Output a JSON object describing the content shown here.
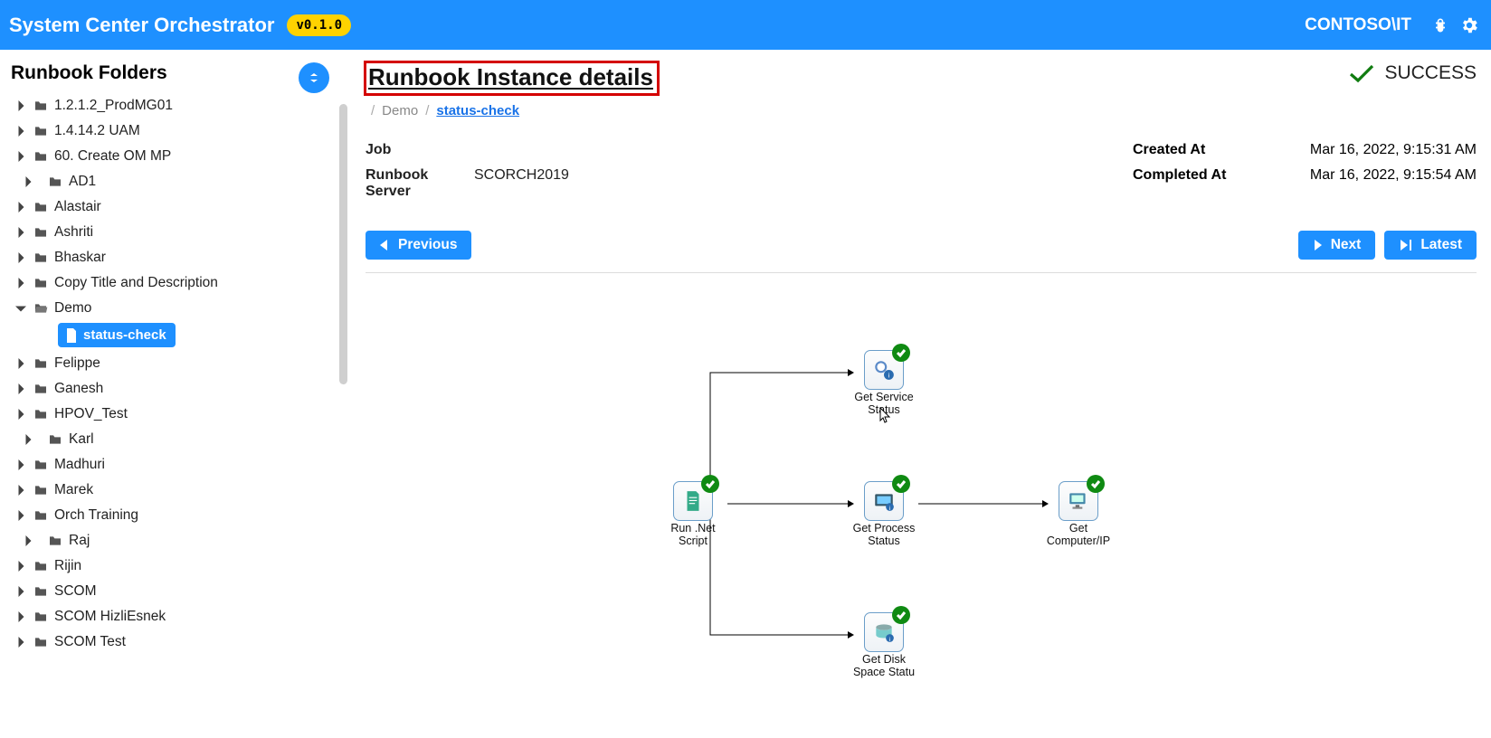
{
  "app": {
    "title": "System Center Orchestrator",
    "version": "v0.1.0",
    "user": "CONTOSO\\IT"
  },
  "sidebar": {
    "title": "Runbook Folders",
    "items": [
      {
        "label": "1.2.1.2_ProdMG01",
        "expanded": false,
        "depth": 1,
        "type": "folder"
      },
      {
        "label": "1.4.14.2 UAM",
        "expanded": false,
        "depth": 1,
        "type": "folder"
      },
      {
        "label": "60. Create OM MP",
        "expanded": false,
        "depth": 1,
        "type": "folder"
      },
      {
        "label": "AD1",
        "expanded": false,
        "depth": 2,
        "type": "folder"
      },
      {
        "label": "Alastair",
        "expanded": false,
        "depth": 1,
        "type": "folder"
      },
      {
        "label": "Ashriti",
        "expanded": false,
        "depth": 1,
        "type": "folder"
      },
      {
        "label": "Bhaskar",
        "expanded": false,
        "depth": 1,
        "type": "folder"
      },
      {
        "label": "Copy Title and Description",
        "expanded": false,
        "depth": 1,
        "type": "folder"
      },
      {
        "label": "Demo",
        "expanded": true,
        "depth": 1,
        "type": "folder-open"
      },
      {
        "label": "status-check",
        "depth": 3,
        "type": "file",
        "selected": true
      },
      {
        "label": "Felippe",
        "expanded": false,
        "depth": 1,
        "type": "folder"
      },
      {
        "label": "Ganesh",
        "expanded": false,
        "depth": 1,
        "type": "folder"
      },
      {
        "label": "HPOV_Test",
        "expanded": false,
        "depth": 1,
        "type": "folder"
      },
      {
        "label": "Karl",
        "expanded": false,
        "depth": 2,
        "type": "folder"
      },
      {
        "label": "Madhuri",
        "expanded": false,
        "depth": 1,
        "type": "folder"
      },
      {
        "label": "Marek",
        "expanded": false,
        "depth": 1,
        "type": "folder"
      },
      {
        "label": "Orch Training",
        "expanded": false,
        "depth": 1,
        "type": "folder"
      },
      {
        "label": "Raj",
        "expanded": false,
        "depth": 2,
        "type": "folder"
      },
      {
        "label": "Rijin",
        "expanded": false,
        "depth": 1,
        "type": "folder"
      },
      {
        "label": "SCOM",
        "expanded": false,
        "depth": 1,
        "type": "folder"
      },
      {
        "label": "SCOM HizliEsnek",
        "expanded": false,
        "depth": 1,
        "type": "folder"
      },
      {
        "label": "SCOM Test",
        "expanded": false,
        "depth": 1,
        "type": "folder"
      }
    ]
  },
  "main": {
    "title": "Runbook Instance details",
    "breadcrumb": {
      "root": "Demo",
      "leaf": "status-check"
    },
    "status": "SUCCESS",
    "meta": {
      "job_label": "Job",
      "job_value": "",
      "server_label": "Runbook Server",
      "server_value": "SCORCH2019",
      "created_label": "Created At",
      "created_value": "Mar 16, 2022, 9:15:31 AM",
      "completed_label": "Completed At",
      "completed_value": "Mar 16, 2022, 9:15:54 AM"
    },
    "buttons": {
      "prev": "Previous",
      "next": "Next",
      "latest": "Latest"
    }
  },
  "diagram": {
    "nodes": {
      "A": "Run .Net Script",
      "B": "Get Service Status",
      "C": "Get Process Status",
      "D": "Get Disk Space Statu",
      "E": "Get Computer/IP"
    }
  }
}
